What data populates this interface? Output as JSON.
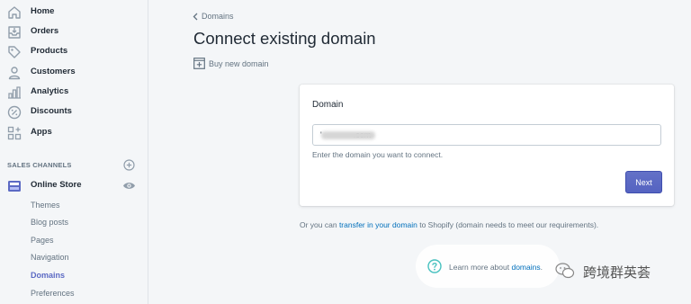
{
  "sidebar": {
    "items": [
      {
        "label": "Home",
        "icon": "home-icon"
      },
      {
        "label": "Orders",
        "icon": "orders-icon"
      },
      {
        "label": "Products",
        "icon": "tag-icon"
      },
      {
        "label": "Customers",
        "icon": "person-icon"
      },
      {
        "label": "Analytics",
        "icon": "bar-chart-icon"
      },
      {
        "label": "Discounts",
        "icon": "discount-icon"
      },
      {
        "label": "Apps",
        "icon": "apps-icon"
      }
    ],
    "sales_channels_title": "SALES CHANNELS",
    "online_store": "Online Store",
    "sub_items": [
      "Themes",
      "Blog posts",
      "Pages",
      "Navigation",
      "Domains",
      "Preferences"
    ],
    "active_sub_item": "Domains"
  },
  "main": {
    "back_label": "Domains",
    "title": "Connect existing domain",
    "buy_link": "Buy new domain",
    "card": {
      "title": "Domain",
      "input_value": "'              .com",
      "help_text": "Enter the domain you want to connect.",
      "next_label": "Next"
    },
    "transfer": {
      "prefix": "Or you can ",
      "link": "transfer in your domain",
      "suffix": " to Shopify (domain needs to meet our requirements)."
    },
    "learn": {
      "prefix": "Learn more about ",
      "link": "domains",
      "suffix": "."
    }
  },
  "watermark": {
    "text": "跨境群英荟"
  },
  "colors": {
    "accent": "#5c6ac4",
    "link": "#006fbb",
    "teal": "#47c1bf",
    "text": "#212b36",
    "muted": "#637381"
  }
}
